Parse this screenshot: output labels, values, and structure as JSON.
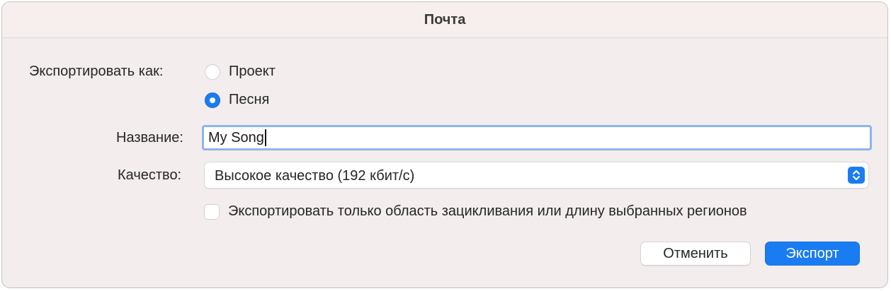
{
  "window": {
    "title": "Почта"
  },
  "export_as": {
    "label": "Экспортировать как:",
    "options": [
      {
        "label": "Проект",
        "selected": false
      },
      {
        "label": "Песня",
        "selected": true
      }
    ]
  },
  "name_field": {
    "label": "Название:",
    "value": "My Song"
  },
  "quality": {
    "label": "Качество:",
    "selected": "Высокое качество (192 кбит/с)"
  },
  "cycle_checkbox": {
    "label": "Экспортировать только область зацикливания или длину выбранных регионов",
    "checked": false
  },
  "buttons": {
    "cancel": "Отменить",
    "export": "Экспорт"
  },
  "colors": {
    "accent": "#1a7cf2",
    "window_bg": "#f3eded",
    "focus_ring": "#8fb4ea"
  },
  "icons": {
    "stepper": "chevron-up-down-icon"
  }
}
